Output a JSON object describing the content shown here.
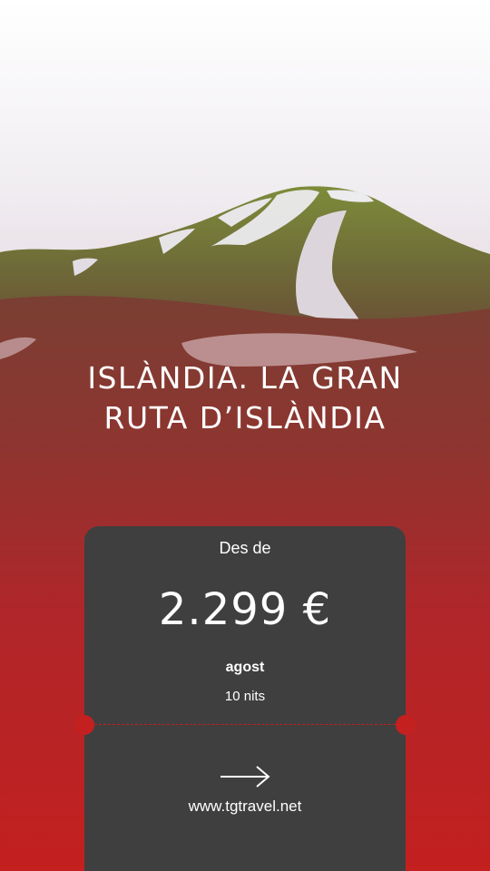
{
  "hero": {
    "title_line1": "ISLÀNDIA. LA GRAN",
    "title_line2": "RUTA D’ISLÀNDIA"
  },
  "offer": {
    "from_label": "Des de",
    "price": "2.299 €",
    "month": "agost",
    "nights": "10 nits"
  },
  "cta": {
    "icon": "arrow-right-icon",
    "website": "www.tgtravel.net"
  },
  "colors": {
    "brand_red": "#c3201f",
    "card": "#3f3f3f",
    "text": "#ffffff"
  }
}
